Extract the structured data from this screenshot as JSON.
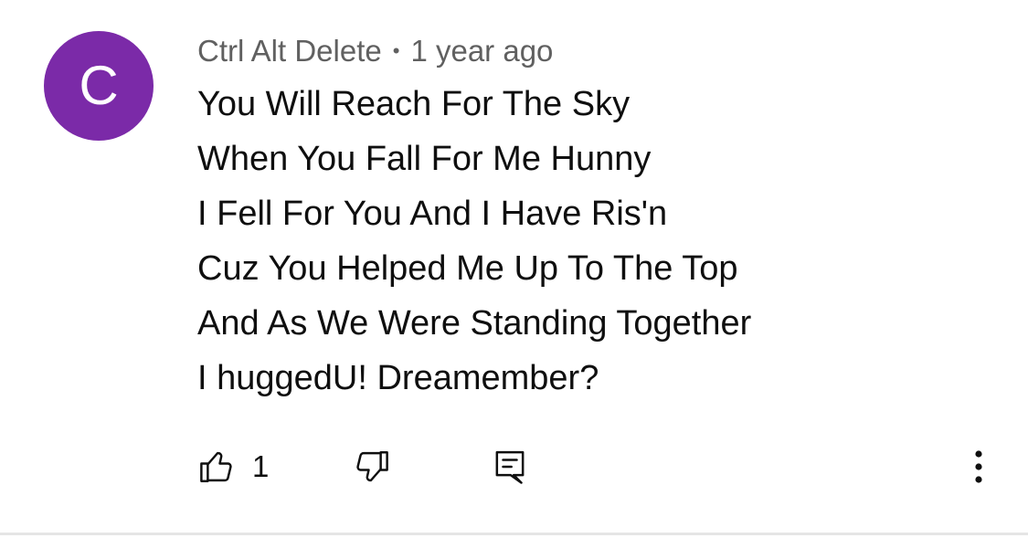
{
  "comment": {
    "avatar_letter": "C",
    "avatar_color": "#7b2aa8",
    "author": "Ctrl Alt Delete",
    "separator": "•",
    "time_ago": "1 year ago",
    "lines": [
      "You Will Reach For The Sky",
      "When You Fall For Me Hunny",
      "I Fell For You And I Have Ris'n",
      "Cuz You Helped Me Up To The Top",
      "And As We Were Standing Together",
      "I huggedU! Dreamember?"
    ]
  },
  "actions": {
    "like_icon": "thumbs-up-icon",
    "like_count": "1",
    "dislike_icon": "thumbs-down-icon",
    "reply_icon": "reply-comment-icon",
    "more_icon": "more-vertical-icon"
  }
}
